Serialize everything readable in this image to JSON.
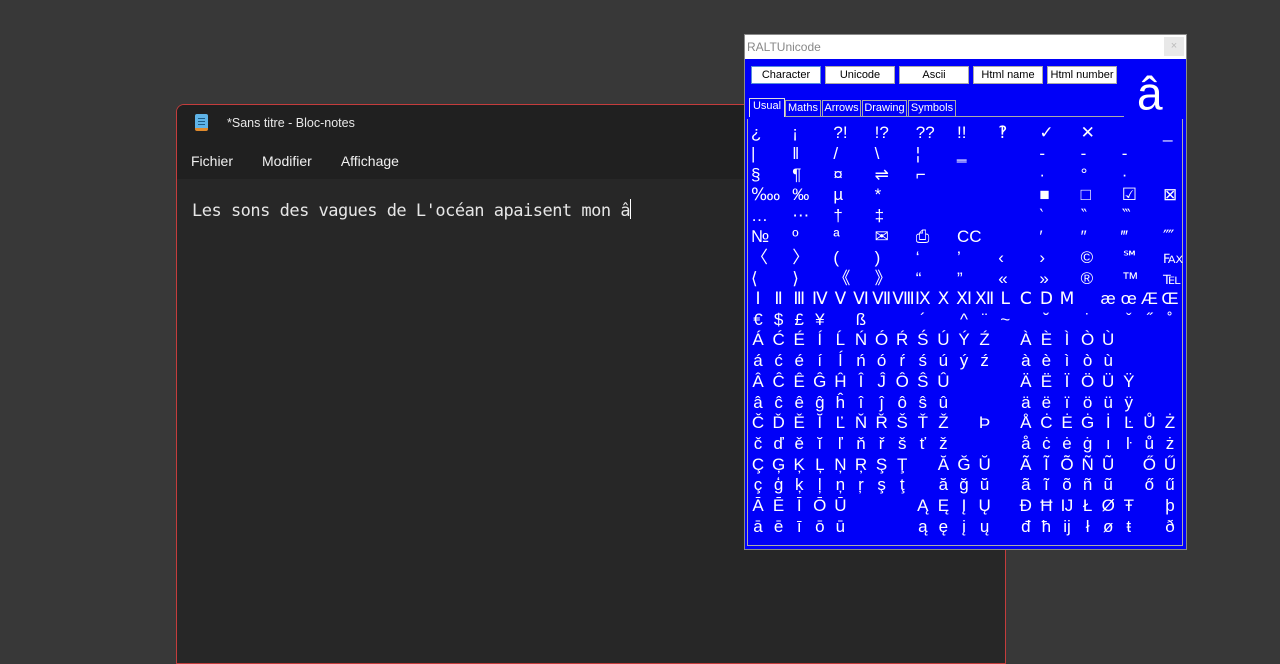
{
  "notepad": {
    "title": "*Sans titre - Bloc-notes",
    "menu": [
      "Fichier",
      "Modifier",
      "Affichage"
    ],
    "text": "Les sons des vagues de L'océan apaisent mon â"
  },
  "ralt": {
    "title": "RALTUnicode",
    "close": "×",
    "buttons": [
      "Character",
      "Unicode",
      "Ascii",
      "Html name",
      "Html number"
    ],
    "preview": "â",
    "tabs": [
      "Usual",
      "Maths",
      "Arrows",
      "Drawing",
      "Symbols"
    ],
    "selected_tab": "Usual",
    "wide_rows": [
      [
        "¿",
        "¡",
        "?!",
        "!?",
        "??",
        "!!",
        "‽",
        "✓",
        "✕",
        "",
        "_"
      ],
      [
        "|",
        "‖",
        "/",
        "\\",
        "¦",
        "‗",
        "",
        "‐",
        "‑",
        "-",
        ""
      ],
      [
        "§",
        "¶",
        "¤",
        "⇌",
        "⌐",
        "",
        "",
        "·",
        "°",
        "·",
        ""
      ],
      [
        "‱",
        "‰",
        "µ",
        "*",
        "",
        "",
        "",
        "■",
        "□",
        "☑",
        "⊠"
      ],
      [
        "…",
        "⋯",
        "†",
        "‡",
        "",
        "",
        "",
        "‵",
        "‶",
        "‷",
        ""
      ],
      [
        "№",
        "º",
        "ª",
        "✉",
        "⎙",
        "CC",
        "",
        "′",
        "″",
        "‴",
        "⁗"
      ],
      [
        "〈",
        "〉",
        "(",
        ")",
        "‘",
        "’",
        "‹",
        "›",
        "©",
        "℠",
        "℻"
      ],
      [
        "⟨",
        "⟩",
        "《",
        "》",
        "“",
        "”",
        "«",
        "»",
        "®",
        "™",
        "℡"
      ]
    ],
    "narrow_rows": [
      [
        "Ⅰ",
        "Ⅱ",
        "Ⅲ",
        "Ⅳ",
        "Ⅴ",
        "Ⅵ",
        "Ⅶ",
        "Ⅷ",
        "Ⅸ",
        "Ⅹ",
        "Ⅺ",
        "Ⅻ",
        "Ⅼ",
        "Ⅽ",
        "Ⅾ",
        "Ⅿ",
        "",
        "æ",
        "œ",
        "Æ",
        "Œ"
      ],
      [
        "€",
        "$",
        "£",
        "¥",
        "",
        "ß",
        "",
        "",
        "´",
        "",
        "^",
        "¨",
        "~",
        "",
        "˘",
        "",
        "˙",
        "",
        "ˇ",
        "˝",
        "˚"
      ],
      [
        "Á",
        "Ć",
        "É",
        "Í",
        "Ĺ",
        "Ń",
        "Ó",
        "Ŕ",
        "Ś",
        "Ú",
        "Ý",
        "Ź",
        "",
        "À",
        "È",
        "Ì",
        "Ò",
        "Ù",
        "",
        "",
        ""
      ],
      [
        "á",
        "ć",
        "é",
        "í",
        "ĺ",
        "ń",
        "ó",
        "ŕ",
        "ś",
        "ú",
        "ý",
        "ź",
        "",
        "à",
        "è",
        "ì",
        "ò",
        "ù",
        "",
        "",
        ""
      ],
      [
        "Â",
        "Ĉ",
        "Ê",
        "Ĝ",
        "Ĥ",
        "Î",
        "Ĵ",
        "Ô",
        "Ŝ",
        "Û",
        "",
        "",
        "",
        "Ä",
        "Ë",
        "Ï",
        "Ö",
        "Ü",
        "Ÿ",
        "",
        ""
      ],
      [
        "â",
        "ĉ",
        "ê",
        "ĝ",
        "ĥ",
        "î",
        "ĵ",
        "ô",
        "ŝ",
        "û",
        "",
        "",
        "",
        "ä",
        "ë",
        "ï",
        "ö",
        "ü",
        "ÿ",
        "",
        ""
      ],
      [
        "Č",
        "Ď",
        "Ě",
        "Ĭ",
        "Ľ",
        "Ň",
        "Ř",
        "Š",
        "Ť",
        "Ž",
        "",
        "Þ",
        "",
        "Å",
        "Ċ",
        "Ė",
        "Ġ",
        "İ",
        "Ŀ",
        "Ů",
        "Ż"
      ],
      [
        "č",
        "ď",
        "ě",
        "ĭ",
        "ľ",
        "ň",
        "ř",
        "š",
        "ť",
        "ž",
        "",
        "",
        "",
        "å",
        "ċ",
        "ė",
        "ġ",
        "ı",
        "ŀ",
        "ů",
        "ż"
      ],
      [
        "Ç",
        "Ģ",
        "Ķ",
        "Ļ",
        "Ņ",
        "Ŗ",
        "Ş",
        "Ţ",
        "",
        "Ă",
        "Ğ",
        "Ŭ",
        "",
        "Ã",
        "Ĩ",
        "Õ",
        "Ñ",
        "Ũ",
        "",
        "Ő",
        "Ű"
      ],
      [
        "ç",
        "ģ",
        "ķ",
        "ļ",
        "ņ",
        "ŗ",
        "ş",
        "ţ",
        "",
        "ă",
        "ğ",
        "ŭ",
        "",
        "ã",
        "ĩ",
        "õ",
        "ñ",
        "ũ",
        "",
        "ő",
        "ű"
      ],
      [
        "Ā",
        "Ē",
        "Ī",
        "Ō",
        "Ū",
        "",
        "",
        "",
        "Ą",
        "Ę",
        "Į",
        "Ų",
        "",
        "Đ",
        "Ħ",
        "Ĳ",
        "Ł",
        "Ø",
        "Ŧ",
        "",
        "þ"
      ],
      [
        "ā",
        "ē",
        "ī",
        "ō",
        "ū",
        "",
        "",
        "",
        "ą",
        "ę",
        "į",
        "ų",
        "",
        "đ",
        "ħ",
        "ĳ",
        "ł",
        "ø",
        "ŧ",
        "",
        "ð"
      ]
    ]
  }
}
